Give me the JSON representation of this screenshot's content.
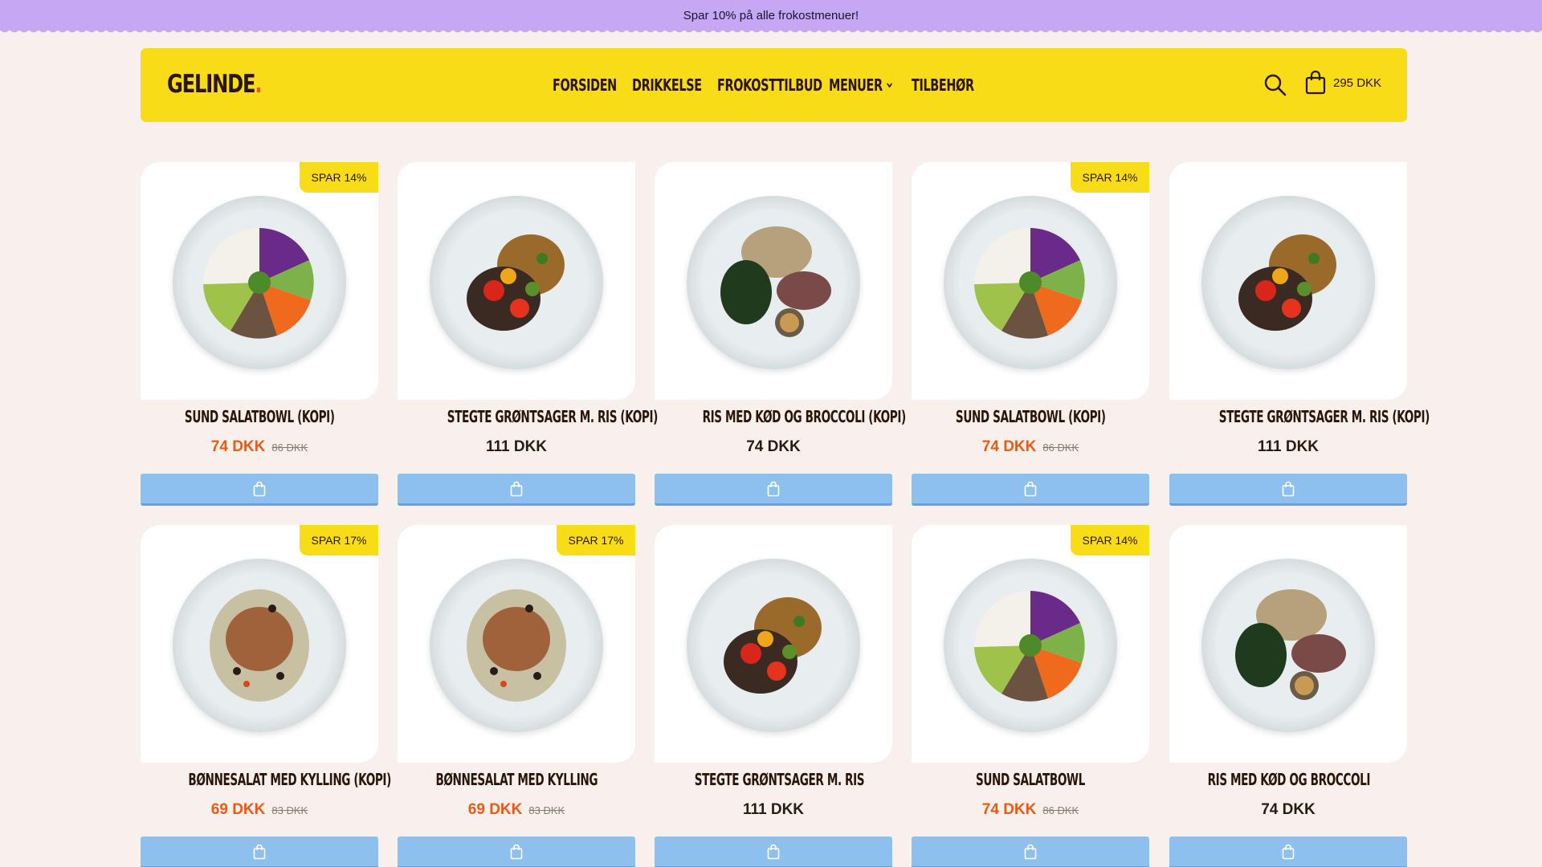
{
  "announcement": {
    "text": "Spar 10% på alle frokostmenuer!"
  },
  "header": {
    "logo": "GELINDE",
    "logo_dot": ".",
    "nav": [
      {
        "label": "FORSIDEN"
      },
      {
        "label": "DRIKKELSE"
      },
      {
        "label": "FROKOSTTILBUD"
      },
      {
        "label": "MENUER"
      },
      {
        "label": "TILBEHØR"
      }
    ],
    "cart_total": "295 DKK"
  },
  "colors": {
    "accent_yellow": "#f8dc18",
    "announcement_purple": "#c6a7f3",
    "button_blue": "#8ec0ee",
    "sale_orange": "#ea5a12",
    "background": "#f8f0ed"
  },
  "products": [
    {
      "title": "SUND SALATBOWL (KOPI)",
      "badge": "SPAR 14%",
      "price": "74 DKK",
      "compare": "86 DKK",
      "sale": true,
      "dish": "salad-bowl"
    },
    {
      "title": "STEGTE GRØNTSAGER M. RIS (KOPI)",
      "badge": "",
      "price": "111 DKK",
      "compare": "",
      "sale": false,
      "dish": "fried-vegetables"
    },
    {
      "title": "RIS MED KØD OG BROCCOLI (KOPI)",
      "badge": "",
      "price": "74 DKK",
      "compare": "",
      "sale": false,
      "dish": "rice-meat-broccoli"
    },
    {
      "title": "SUND SALATBOWL (KOPI)",
      "badge": "SPAR 14%",
      "price": "74 DKK",
      "compare": "86 DKK",
      "sale": true,
      "dish": "salad-bowl"
    },
    {
      "title": "STEGTE GRØNTSAGER M. RIS (KOPI)",
      "badge": "",
      "price": "111 DKK",
      "compare": "",
      "sale": false,
      "dish": "fried-vegetables"
    },
    {
      "title": "BØNNESALAT MED KYLLING (KOPI)",
      "badge": "SPAR 17%",
      "price": "69 DKK",
      "compare": "83 DKK",
      "sale": true,
      "dish": "bean-chicken"
    },
    {
      "title": "BØNNESALAT MED KYLLING",
      "badge": "SPAR 17%",
      "price": "69 DKK",
      "compare": "83 DKK",
      "sale": true,
      "dish": "bean-chicken"
    },
    {
      "title": "STEGTE GRØNTSAGER M. RIS",
      "badge": "",
      "price": "111 DKK",
      "compare": "",
      "sale": false,
      "dish": "fried-vegetables"
    },
    {
      "title": "SUND SALATBOWL",
      "badge": "SPAR 14%",
      "price": "74 DKK",
      "compare": "86 DKK",
      "sale": true,
      "dish": "salad-bowl"
    },
    {
      "title": "RIS MED KØD OG BROCCOLI",
      "badge": "",
      "price": "74 DKK",
      "compare": "",
      "sale": false,
      "dish": "rice-meat-broccoli"
    }
  ]
}
